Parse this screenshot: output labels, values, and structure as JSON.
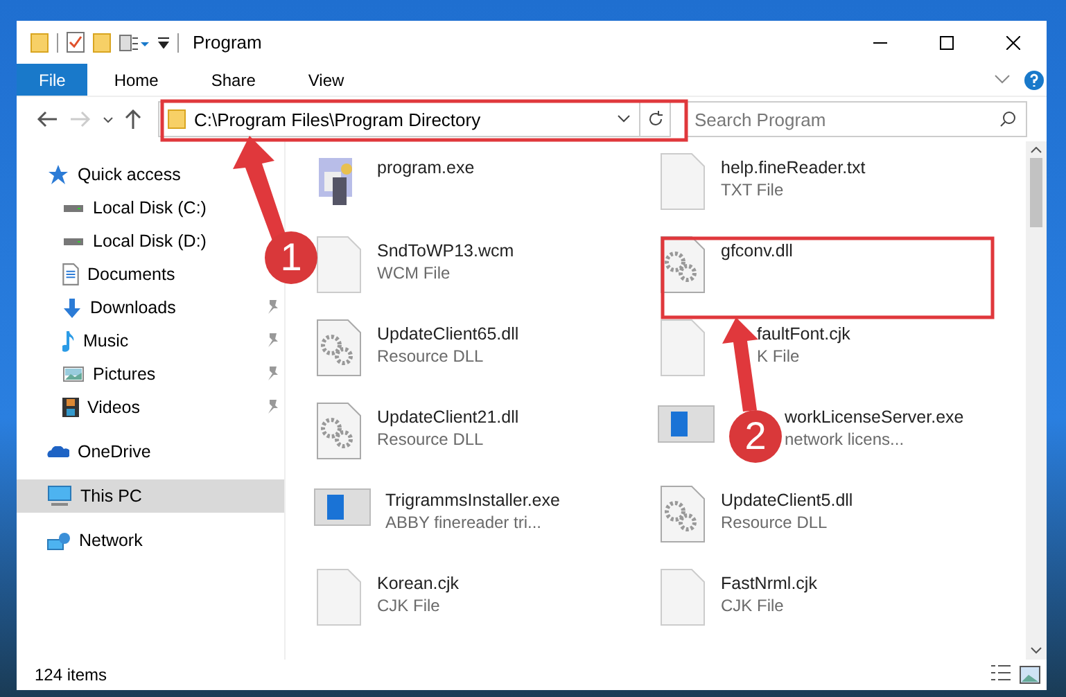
{
  "window": {
    "title": "Program"
  },
  "ribbon_tabs": [
    {
      "label": "File",
      "selected": true
    },
    {
      "label": "Home",
      "selected": false
    },
    {
      "label": "Share",
      "selected": false
    },
    {
      "label": "View",
      "selected": false
    }
  ],
  "address_bar": {
    "path": "C:\\Program Files\\Program Directory"
  },
  "search": {
    "placeholder": "Search Program"
  },
  "navigation": [
    {
      "label": "Quick access",
      "kind": "star",
      "selected": false,
      "children": [
        {
          "label": "Local Disk (C:)",
          "kind": "disk",
          "pinned": false,
          "selected": false
        },
        {
          "label": "Local Disk (D:)",
          "kind": "disk",
          "pinned": false,
          "selected": false
        },
        {
          "label": "Documents",
          "kind": "document",
          "pinned": false,
          "selected": false
        },
        {
          "label": "Downloads",
          "kind": "download",
          "pinned": true,
          "selected": false
        },
        {
          "label": "Music",
          "kind": "music",
          "pinned": true,
          "selected": false
        },
        {
          "label": "Pictures",
          "kind": "pictures",
          "pinned": true,
          "selected": false
        },
        {
          "label": "Videos",
          "kind": "videos",
          "pinned": true,
          "selected": false
        }
      ]
    },
    {
      "label": "OneDrive",
      "kind": "cloud",
      "selected": false
    },
    {
      "label": "This PC",
      "kind": "pc",
      "selected": true
    },
    {
      "label": "Network",
      "kind": "network",
      "selected": false
    }
  ],
  "files": [
    {
      "name": "program.exe",
      "kind": "program"
    },
    {
      "name": "help.fineReader.txt",
      "type": "TXT File",
      "kind": "blank"
    },
    {
      "name": "SndToWP13.wcm",
      "type": "WCM File",
      "kind": "blank"
    },
    {
      "name": "gfconv.dll",
      "kind": "dll"
    },
    {
      "name": "UpdateClient65.dll",
      "type": "Resource DLL",
      "kind": "dll"
    },
    {
      "name": "faultFont.cjk",
      "type": "K File",
      "kind": "blank"
    },
    {
      "name": "UpdateClient21.dll",
      "type": "Resource DLL",
      "kind": "dll"
    },
    {
      "name": "workLicenseServer.exe",
      "type": "network licens...",
      "kind": "installer"
    },
    {
      "name": "TrigrammsInstaller.exe",
      "type": "ABBY finereader tri...",
      "kind": "installer"
    },
    {
      "name": "UpdateClient5.dll",
      "type": "Resource DLL",
      "kind": "dll"
    },
    {
      "name": "Korean.cjk",
      "type": "CJK File",
      "kind": "blank"
    },
    {
      "name": "FastNrml.cjk",
      "type": "CJK File",
      "kind": "blank"
    }
  ],
  "status_bar": {
    "item_count": "124 items"
  },
  "annotations": [
    {
      "number": "1"
    },
    {
      "number": "2"
    }
  ]
}
